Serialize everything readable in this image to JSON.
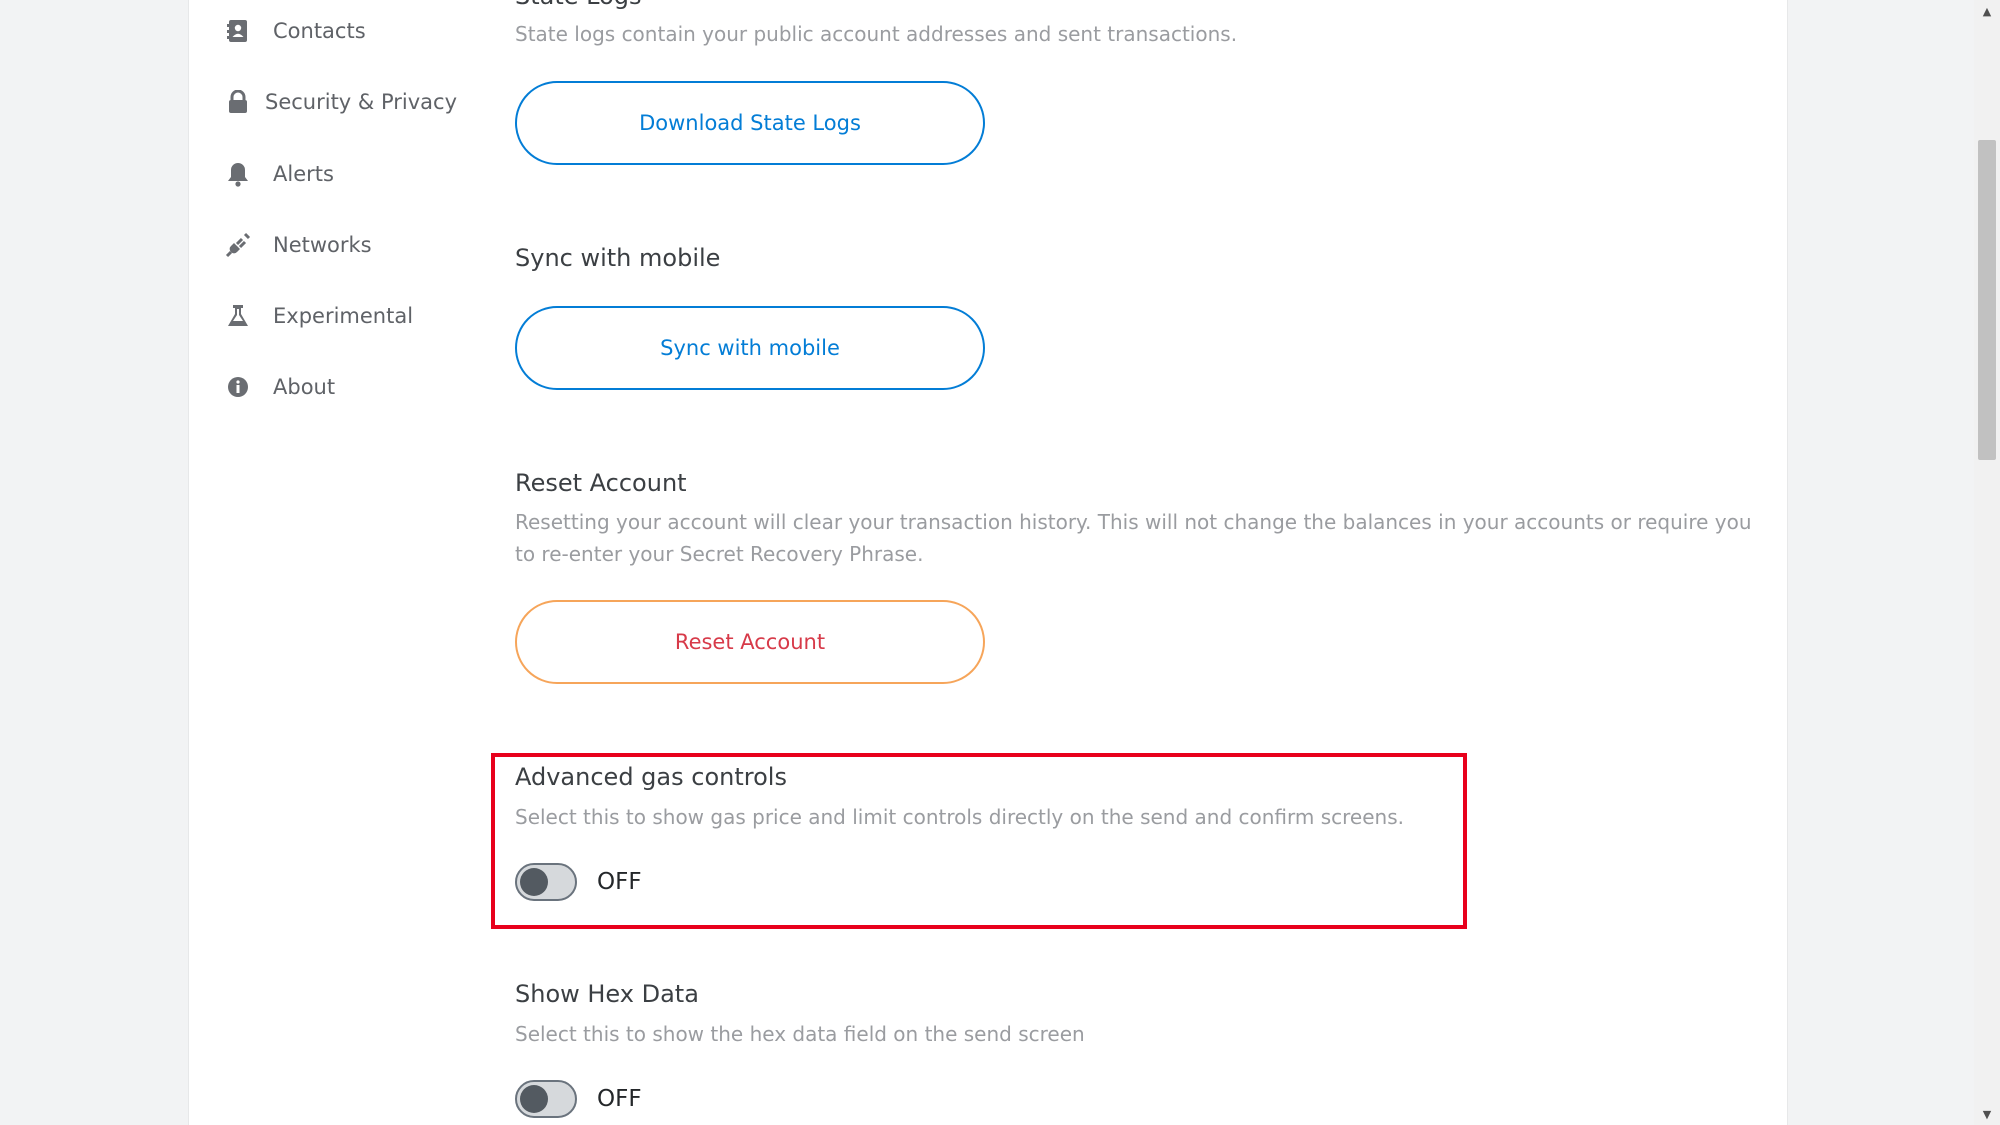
{
  "sidebar": {
    "items": [
      {
        "label": "Contacts",
        "icon": "contacts-icon"
      },
      {
        "label": "Security & Privacy",
        "icon": "lock-icon"
      },
      {
        "label": "Alerts",
        "icon": "bell-icon"
      },
      {
        "label": "Networks",
        "icon": "plug-icon"
      },
      {
        "label": "Experimental",
        "icon": "flask-icon"
      },
      {
        "label": "About",
        "icon": "info-icon"
      }
    ]
  },
  "advanced": {
    "state_logs": {
      "title": "State Logs",
      "description": "State logs contain your public account addresses and sent transactions.",
      "button": "Download State Logs"
    },
    "sync_mobile": {
      "title": "Sync with mobile",
      "button": "Sync with mobile"
    },
    "reset_account": {
      "title": "Reset Account",
      "description": "Resetting your account will clear your transaction history. This will not change the balances in your accounts or require you to re-enter your Secret Recovery Phrase.",
      "button": "Reset Account"
    },
    "advanced_gas": {
      "title": "Advanced gas controls",
      "description": "Select this to show gas price and limit controls directly on the send and confirm screens.",
      "toggle_state": "OFF"
    },
    "hex_data": {
      "title": "Show Hex Data",
      "description": "Select this to show the hex data field on the send screen",
      "toggle_state": "OFF"
    }
  },
  "colors": {
    "primary": "#037dd6",
    "danger": "#d73a49",
    "danger_border": "#f6a55a",
    "highlight": "#e8001c"
  }
}
